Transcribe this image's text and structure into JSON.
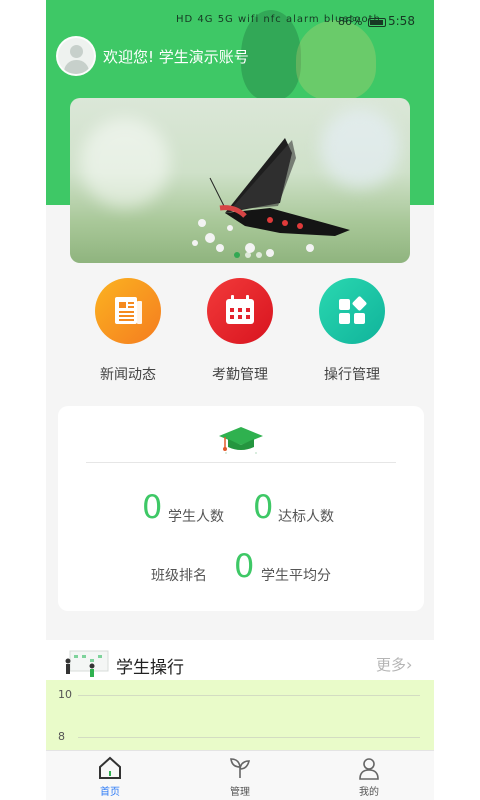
{
  "status": {
    "time": "5:58",
    "battery": "86%",
    "icons": "HD 4G 5G wifi nfc alarm bluetooth"
  },
  "header": {
    "welcome": "欢迎您! 学生演示账号"
  },
  "menu": [
    {
      "label": "新闻动态",
      "icon": "newspaper-icon",
      "color": "#f7901e"
    },
    {
      "label": "考勤管理",
      "icon": "calendar-icon",
      "color": "#e8202e"
    },
    {
      "label": "操行管理",
      "icon": "apps-icon",
      "color": "#17c3a5"
    }
  ],
  "stats": {
    "student_count_value": "0",
    "student_count_label": "学生人数",
    "qualified_value": "0",
    "qualified_label": "达标人数",
    "rank_label": "班级排名",
    "average_value": "0",
    "average_label": "学生平均分"
  },
  "conduct": {
    "title": "学生操行",
    "more": "更多",
    "ticks": [
      "10",
      "8"
    ]
  },
  "tabbar": [
    {
      "label": "首页",
      "icon": "home-icon",
      "active": true
    },
    {
      "label": "管理",
      "icon": "sprout-icon",
      "active": false
    },
    {
      "label": "我的",
      "icon": "user-icon",
      "active": false
    }
  ],
  "colors": {
    "brand": "#3ec866",
    "active_tab": "#2e7cf6",
    "chart_bg": "#e9fbc9"
  }
}
